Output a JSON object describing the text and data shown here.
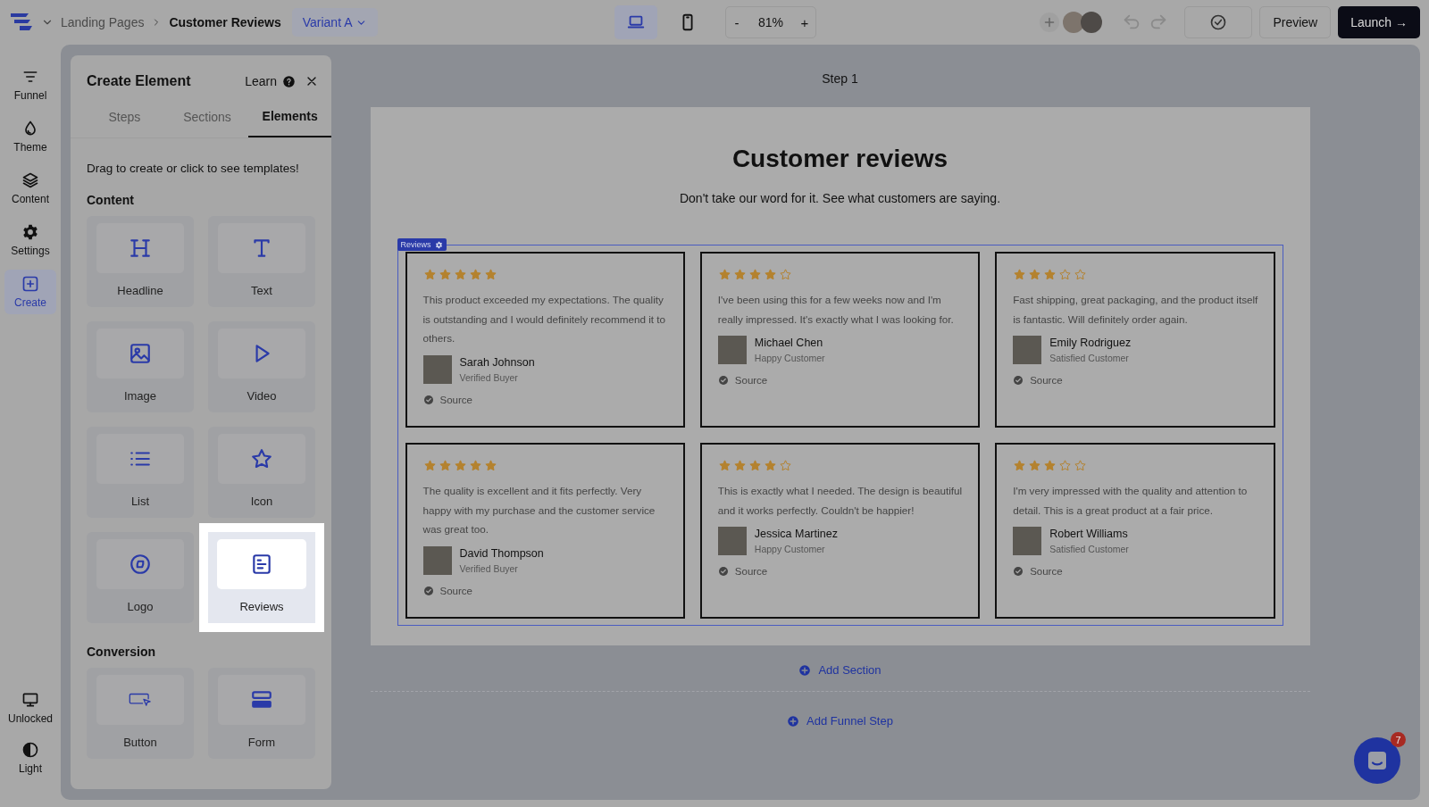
{
  "topbar": {
    "breadcrumb": [
      {
        "label": "Landing Pages",
        "current": false
      },
      {
        "label": "Customer Reviews",
        "current": true
      }
    ],
    "variant": "Variant A",
    "devices": [
      {
        "kind": "desktop",
        "selected": true
      },
      {
        "kind": "mobile",
        "selected": false
      }
    ],
    "zoom": {
      "minus": "-",
      "value": "81%",
      "plus": "+"
    },
    "preview": "Preview",
    "launch": "Launch →"
  },
  "rail": {
    "items": [
      {
        "label": "Funnel",
        "selected": false
      },
      {
        "label": "Theme",
        "selected": false
      },
      {
        "label": "Content",
        "selected": false
      },
      {
        "label": "Settings",
        "selected": false
      },
      {
        "label": "Create",
        "selected": true
      }
    ],
    "bottom": [
      {
        "label": "Unlocked"
      },
      {
        "label": "Light"
      }
    ]
  },
  "panel": {
    "title": "Create Element",
    "learn": "Learn",
    "tabs": [
      {
        "label": "Steps",
        "selected": false
      },
      {
        "label": "Sections",
        "selected": false
      },
      {
        "label": "Elements",
        "selected": true
      }
    ],
    "hint": "Drag to create or click to see templates!",
    "sections": [
      {
        "title": "Content",
        "elements": [
          {
            "label": "Headline",
            "highlighted": false
          },
          {
            "label": "Text",
            "highlighted": false
          },
          {
            "label": "Image",
            "highlighted": false
          },
          {
            "label": "Video",
            "highlighted": false
          },
          {
            "label": "List",
            "highlighted": false
          },
          {
            "label": "Icon",
            "highlighted": false
          },
          {
            "label": "Logo",
            "highlighted": false
          },
          {
            "label": "Reviews",
            "highlighted": true
          }
        ]
      },
      {
        "title": "Conversion",
        "elements": [
          {
            "label": "Button",
            "highlighted": false
          },
          {
            "label": "Form",
            "highlighted": false
          }
        ]
      }
    ]
  },
  "canvas": {
    "step_label": "Step 1",
    "heading": "Customer reviews",
    "subheading": "Don't take our word for it. See what customers are saying.",
    "reviews_tag": "Reviews",
    "reviews": [
      {
        "stars": 5,
        "text": "This product exceeded my expectations. The quality is outstanding and I would definitely recommend it to others.",
        "name": "Sarah Johnson",
        "role": "Verified Buyer",
        "source": "Source"
      },
      {
        "stars": 4,
        "text": "I've been using this for a few weeks now and I'm really impressed. It's exactly what I was looking for.",
        "name": "Michael Chen",
        "role": "Happy Customer",
        "source": "Source"
      },
      {
        "stars": 3,
        "text": "Fast shipping, great packaging, and the product itself is fantastic. Will definitely order again.",
        "name": "Emily Rodriguez",
        "role": "Satisfied Customer",
        "source": "Source"
      },
      {
        "stars": 5,
        "text": "The quality is excellent and it fits perfectly. Very happy with my purchase and the customer service was great too.",
        "name": "David Thompson",
        "role": "Verified Buyer",
        "source": "Source"
      },
      {
        "stars": 4,
        "text": "This is exactly what I needed. The design is beautiful and it works perfectly. Couldn't be happier!",
        "name": "Jessica Martinez",
        "role": "Happy Customer",
        "source": "Source"
      },
      {
        "stars": 3,
        "text": "I'm very impressed with the quality and attention to detail. This is a great product at a fair price.",
        "name": "Robert Williams",
        "role": "Satisfied Customer",
        "source": "Source"
      }
    ],
    "add_section": "Add Section",
    "add_step": "Add Funnel Step",
    "chat_badge": "7"
  }
}
